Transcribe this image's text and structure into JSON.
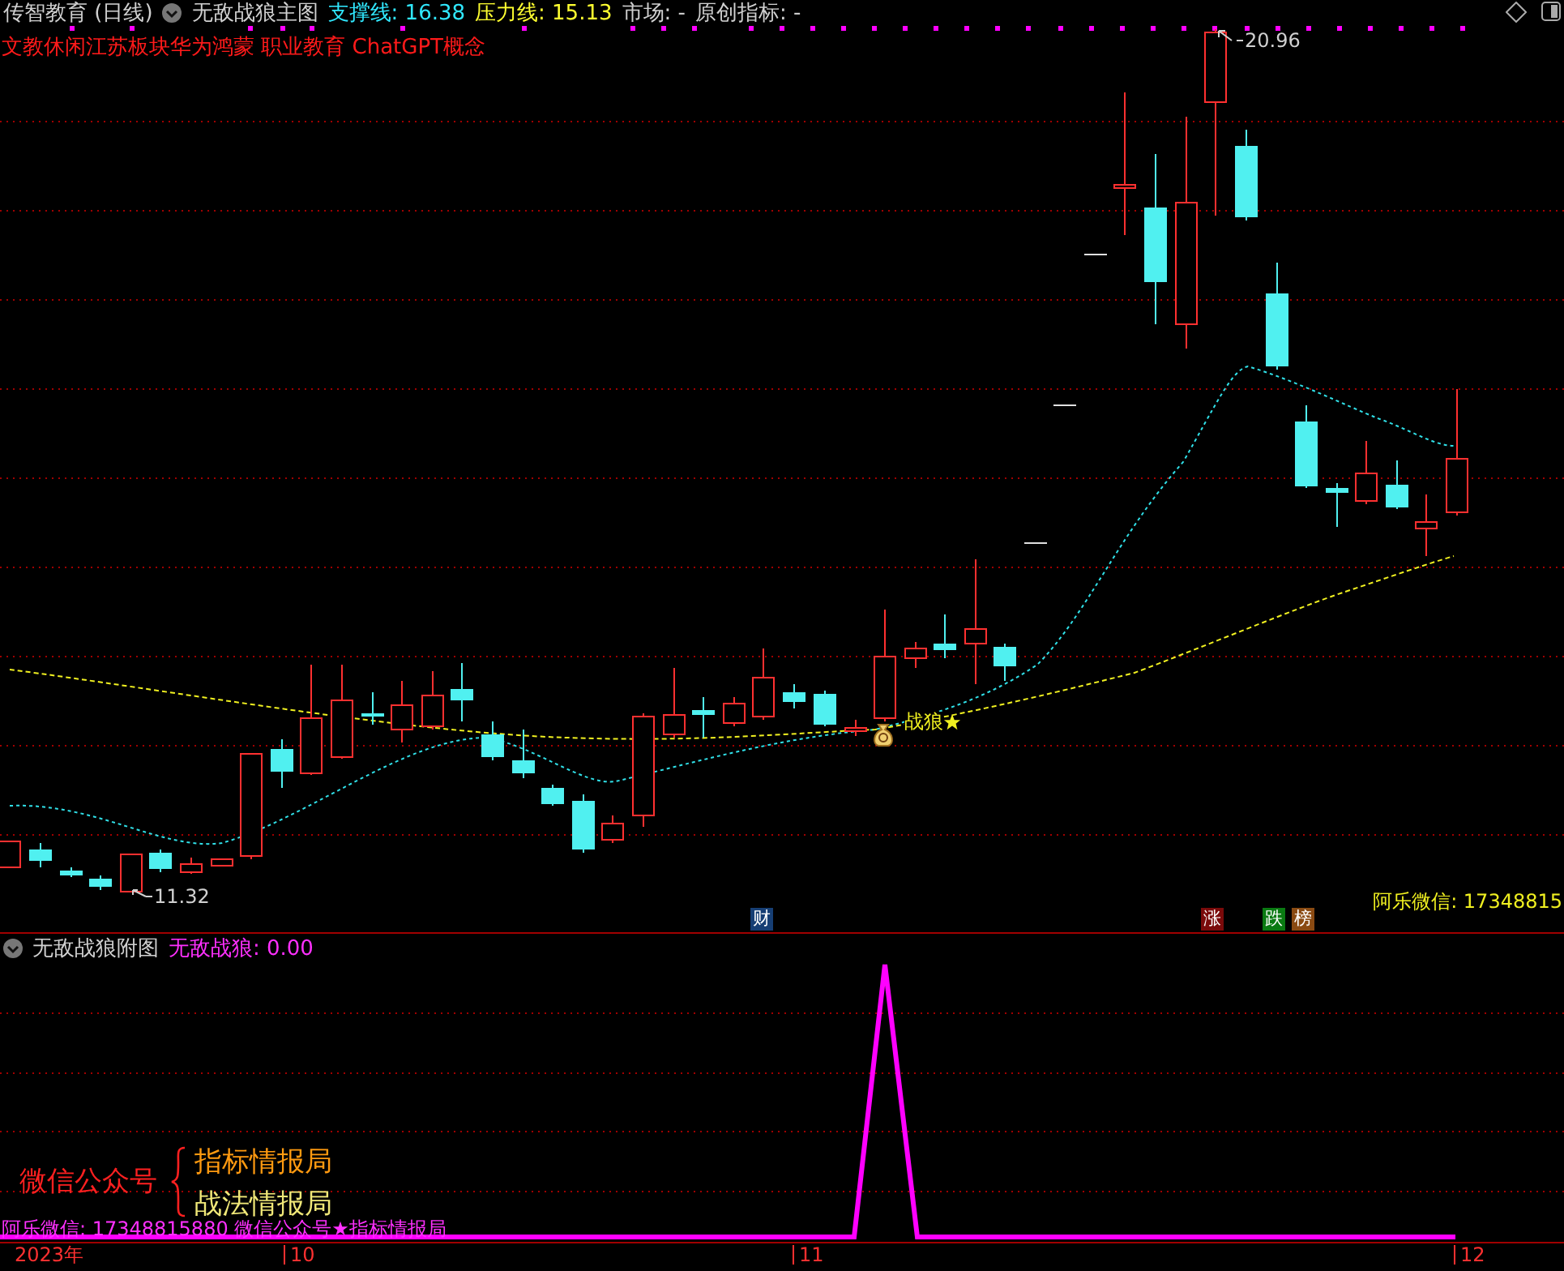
{
  "header": [
    {
      "kind": "title",
      "text": "传智教育 (日线)"
    },
    {
      "kind": "menu",
      "text": "无敌战狼主图"
    },
    {
      "kind": "support",
      "text": "支撑线: 16.38"
    },
    {
      "kind": "pressure",
      "text": "压力线: 15.13"
    },
    {
      "kind": "plain",
      "text": "市场: -"
    },
    {
      "kind": "plain",
      "text": "原创指标: -"
    }
  ],
  "concepts": "文教休闲江苏板块华为鸿蒙 职业教育 ChatGPT概念",
  "main_chart": {
    "high_label": "20.96",
    "low_label": "11.32",
    "signal_label": "战狼",
    "right_note": "阿乐微信: 17348815",
    "badges": [
      {
        "text": "财",
        "color": "#163e74"
      },
      {
        "text": "涨",
        "color": "#7a0a0a"
      },
      {
        "text": "跌",
        "color": "#0a7a12"
      },
      {
        "text": "榜",
        "color": "#8a4a12"
      }
    ]
  },
  "sub_chart": {
    "title": "无敌战狼附图",
    "reading": "无敌战狼: 0.00",
    "promo_left": "微信公众号",
    "promo_lines": [
      "指标情报局",
      "战法情报局"
    ],
    "footer_note": "阿乐微信: 17348815880  微信公众号★指标情报局"
  },
  "x_axis": [
    "2023年",
    "10",
    "11",
    "12"
  ]
}
